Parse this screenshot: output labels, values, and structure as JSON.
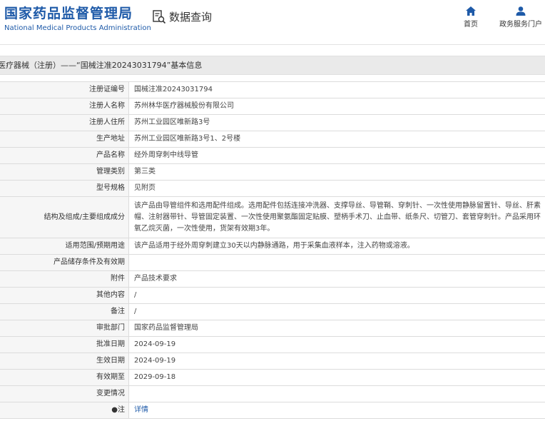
{
  "header": {
    "logo_cn": "国家药品监督管理局",
    "logo_en": "National Medical Products Administration",
    "query_label": "数据查询",
    "nav": [
      {
        "label": "首页",
        "icon": "home-icon"
      },
      {
        "label": "政务服务门户",
        "icon": "user-icon"
      }
    ]
  },
  "title_bar": "医疗器械（注册）——“国械注准20243031794”基本信息",
  "rows": [
    {
      "label": "注册证编号",
      "value": "国械注准20243031794"
    },
    {
      "label": "注册人名称",
      "value": "苏州林华医疗器械股份有限公司"
    },
    {
      "label": "注册人住所",
      "value": "苏州工业园区唯新路3号"
    },
    {
      "label": "生产地址",
      "value": "苏州工业园区唯新路3号1、2号楼"
    },
    {
      "label": "产品名称",
      "value": "经外周穿刺中线导管"
    },
    {
      "label": "管理类别",
      "value": "第三类"
    },
    {
      "label": "型号规格",
      "value": "见附页"
    },
    {
      "label": "结构及组成/主要组成成分",
      "value": "该产品由导管组件和选用配件组成。选用配件包括连接冲洗器、支撑导丝、导管鞘、穿刺针、一次性使用静脉留置针、导丝、肝素帽、注射器带针、导管固定装置、一次性使用聚氨酯固定贴膜、塑柄手术刀、止血带、纸条尺、切管刀、套管穿刺针。产品采用环氧乙烷灭菌，一次性使用，货架有效期3年。"
    },
    {
      "label": "适用范围/预期用途",
      "value": "该产品适用于经外周穿刺建立30天以内静脉通路，用于采集血液样本，注入药物或溶液。"
    },
    {
      "label": "产品储存条件及有效期",
      "value": ""
    },
    {
      "label": "附件",
      "value": "产品技术要求"
    },
    {
      "label": "其他内容",
      "value": "/"
    },
    {
      "label": "备注",
      "value": "/"
    },
    {
      "label": "审批部门",
      "value": "国家药品监督管理局"
    },
    {
      "label": "批准日期",
      "value": "2024-09-19"
    },
    {
      "label": "生效日期",
      "value": "2024-09-19"
    },
    {
      "label": "有效期至",
      "value": "2029-09-18"
    },
    {
      "label": "变更情况",
      "value": ""
    },
    {
      "label": "●注",
      "value": "详情"
    }
  ],
  "colors": {
    "brand": "#1e5aa8",
    "label_bg": "#f6f6f6",
    "border": "#dcdcdc"
  }
}
